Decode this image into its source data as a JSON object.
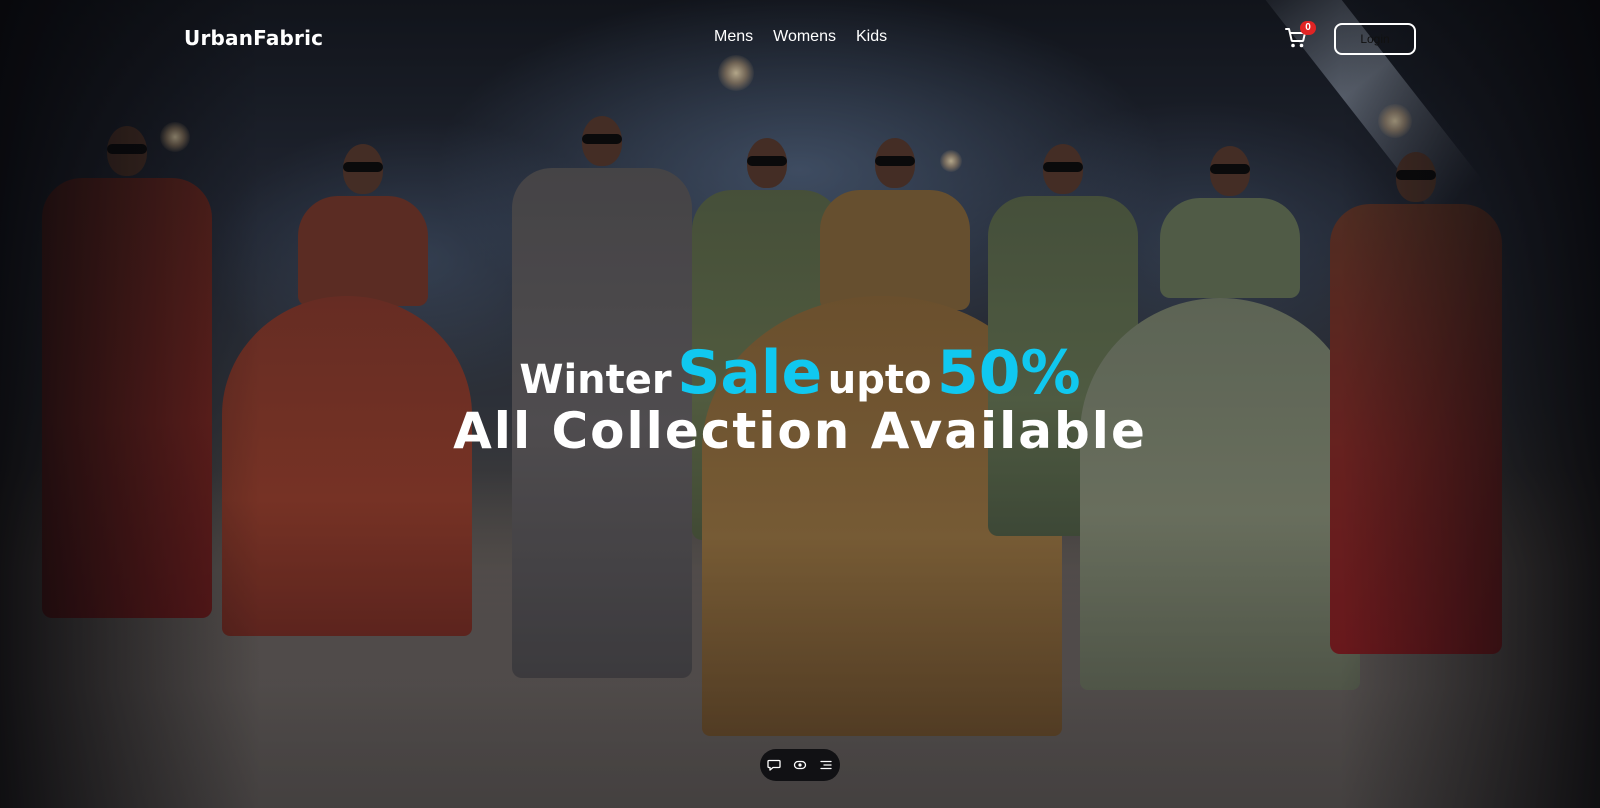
{
  "brand": "UrbanFabric",
  "nav": {
    "links": [
      "Mens",
      "Womens",
      "Kids"
    ]
  },
  "cart": {
    "icon": "shopping-cart-icon",
    "count": "0",
    "badge_color": "#e02424"
  },
  "login_button": {
    "label": "Login"
  },
  "hero": {
    "line1": {
      "word1": "Winter",
      "word2": "Sale",
      "word3": "upto",
      "word4": "50%"
    },
    "line2": "All Collection Available",
    "accent_color": "#10c8f0"
  },
  "toolbar": {
    "icons": [
      "comment-icon",
      "view-icon",
      "menu-icon"
    ]
  }
}
